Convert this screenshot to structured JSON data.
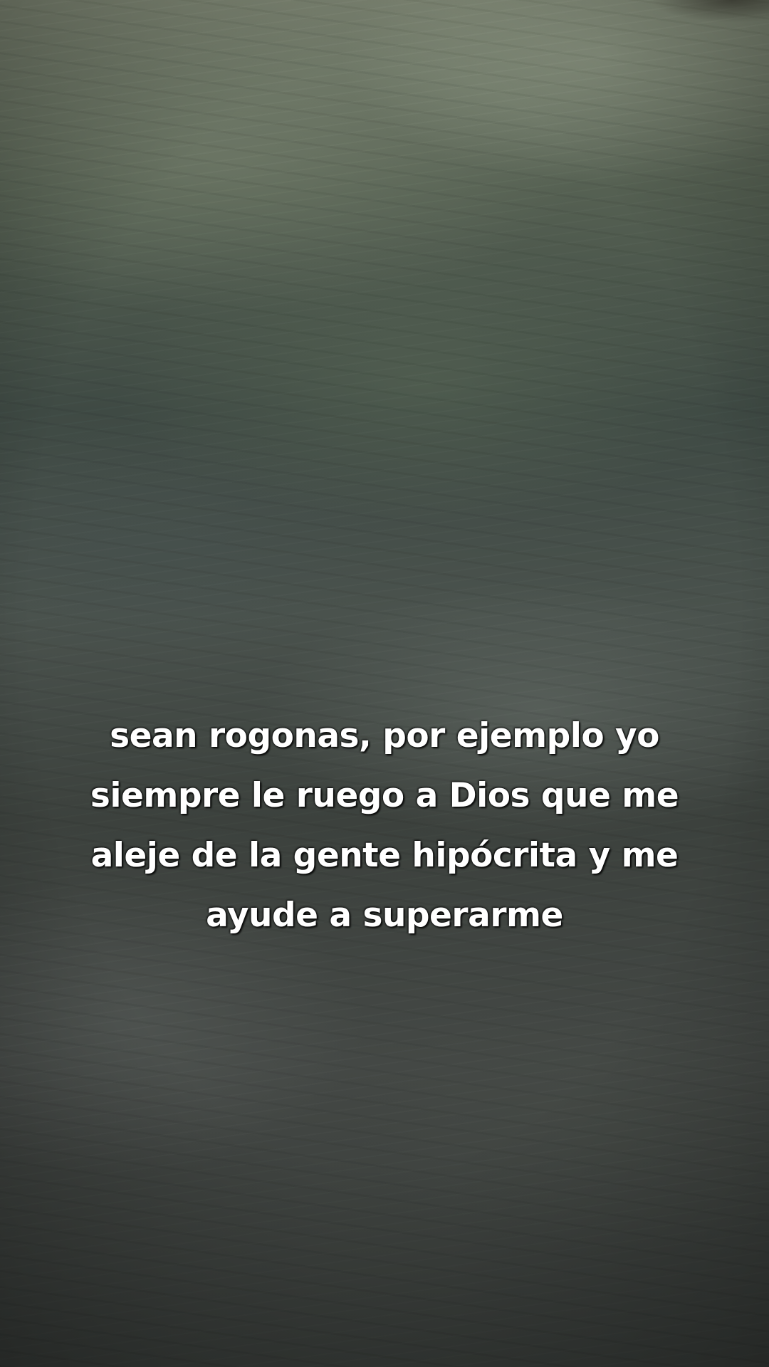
{
  "caption": {
    "lines": [
      "sean rogonas, por ejemplo yo",
      "siempre le ruego a Dios que me",
      "aleje de la gente hipócrita y me",
      "ayude a superarme"
    ]
  }
}
